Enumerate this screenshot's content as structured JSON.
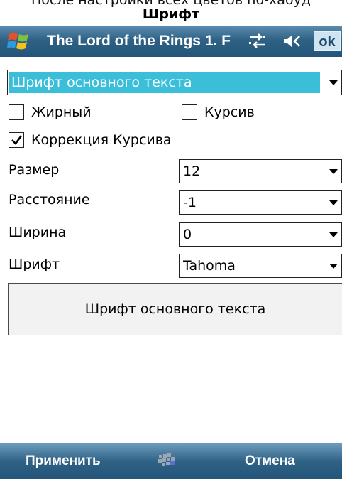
{
  "caption": {
    "top_text": "После настройки всех цветов по-хабуд",
    "title": "Шрифт"
  },
  "titlebar": {
    "app_title": "The Lord of the Rings 1. F",
    "ok_label": "ok",
    "icons": [
      "windows-logo-icon",
      "connectivity-icon",
      "speaker-icon"
    ]
  },
  "font_target": {
    "selected": "Шрифт основного текста"
  },
  "checkboxes": {
    "bold": {
      "label": "Жирный",
      "checked": false
    },
    "italic": {
      "label": "Курсив",
      "checked": false
    },
    "italic_correction": {
      "label": "Коррекция Курсива",
      "checked": true
    }
  },
  "fields": {
    "size": {
      "label": "Размер",
      "value": "12"
    },
    "spacing": {
      "label": "Расстояние",
      "value": "-1"
    },
    "width": {
      "label": "Ширина",
      "value": "0"
    },
    "font": {
      "label": "Шрифт",
      "value": "Tahoma"
    }
  },
  "preview": {
    "text": "Шрифт основного текста"
  },
  "softkeys": {
    "left": "Применить",
    "right": "Отмена",
    "center_icon": "keyboard-icon"
  },
  "colors": {
    "titlebar": "#2f6285",
    "selection": "#3bbfd9",
    "ok_button": "#cfe3f1"
  }
}
